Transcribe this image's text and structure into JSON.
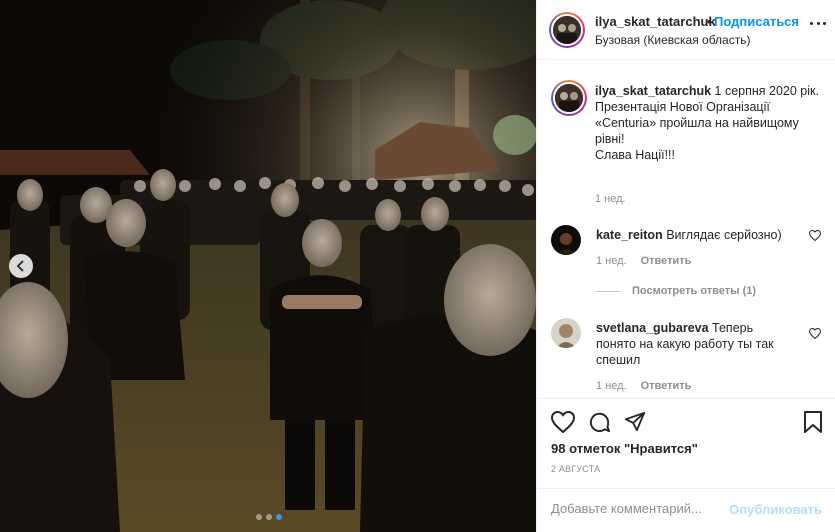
{
  "post": {
    "username": "ilya_skat_tatarchuk",
    "separator": "•",
    "follow_label": "Подписаться",
    "location": "Бузовая (Киевская область)"
  },
  "caption": {
    "username": "ilya_skat_tatarchuk",
    "date_text": " 1 серпня 2020 рік.",
    "body_lines": [
      "Презентація Нової Організації",
      "«Centuria» пройшла на найвищому",
      "рівні!",
      "Слава Нації!!!"
    ],
    "age": "1 нед."
  },
  "comments": [
    {
      "username": "kate_reiton",
      "text": "Виглядає серйозно)",
      "age": "1 нед.",
      "reply_label": "Ответить"
    },
    {
      "username": "svetlana_gubareva",
      "text": "Теперь понято на какую работу ты так спешил",
      "age": "1 нед.",
      "reply_label": "Ответить"
    }
  ],
  "view_replies": "Посмотреть ответы (1)",
  "likes": "98 отметок \"Нравится\"",
  "date": "2 АВГУСТА",
  "add_comment": {
    "placeholder": "Добавьте комментарий...",
    "publish_label": "Опубликовать"
  },
  "icons": {
    "like": "heart-icon",
    "comment": "comment-icon",
    "share": "share-icon",
    "save": "bookmark-icon",
    "more": "more-options-icon",
    "prev": "chevron-left-icon"
  },
  "carousel": {
    "total": 3,
    "active_index": 2
  },
  "colors": {
    "link_blue": "#0095f6",
    "muted": "#8e8e8e",
    "publish_disabled": "#b2dffc"
  }
}
